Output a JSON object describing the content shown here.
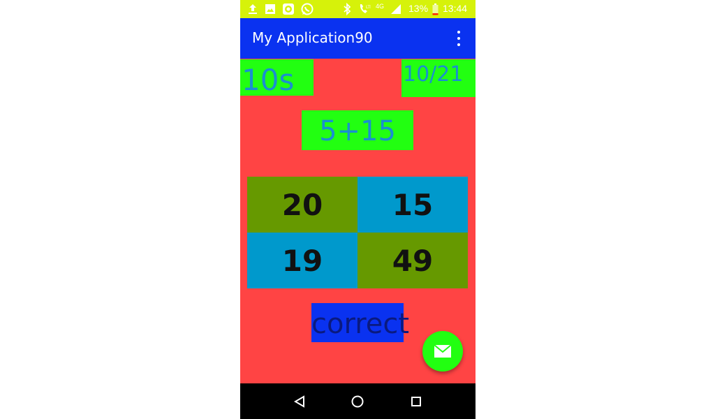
{
  "status_bar": {
    "battery_percent": "13%",
    "network": "4G",
    "time": "13:44",
    "icons": [
      "upload-icon",
      "image-icon",
      "camera-app-icon",
      "whatsapp-icon",
      "bluetooth-icon",
      "wifi-call-icon",
      "signal-icon",
      "battery-icon"
    ],
    "battery_level": 0.13
  },
  "app_bar": {
    "title": "My Application90"
  },
  "game": {
    "timer": "10s",
    "score": "10/21",
    "question": "5+15",
    "answers": [
      "20",
      "15",
      "19",
      "49"
    ],
    "result": "correct"
  },
  "fab": {
    "icon": "mail-icon"
  },
  "nav_bar": {
    "icons": [
      "back-icon",
      "home-icon",
      "recents-icon"
    ]
  },
  "colors": {
    "status_bar": "#d6f20a",
    "app_bar": "#0a32f0",
    "background": "#ff4444",
    "green": "#22ff11",
    "olive": "#669900",
    "blue": "#0099cc"
  }
}
